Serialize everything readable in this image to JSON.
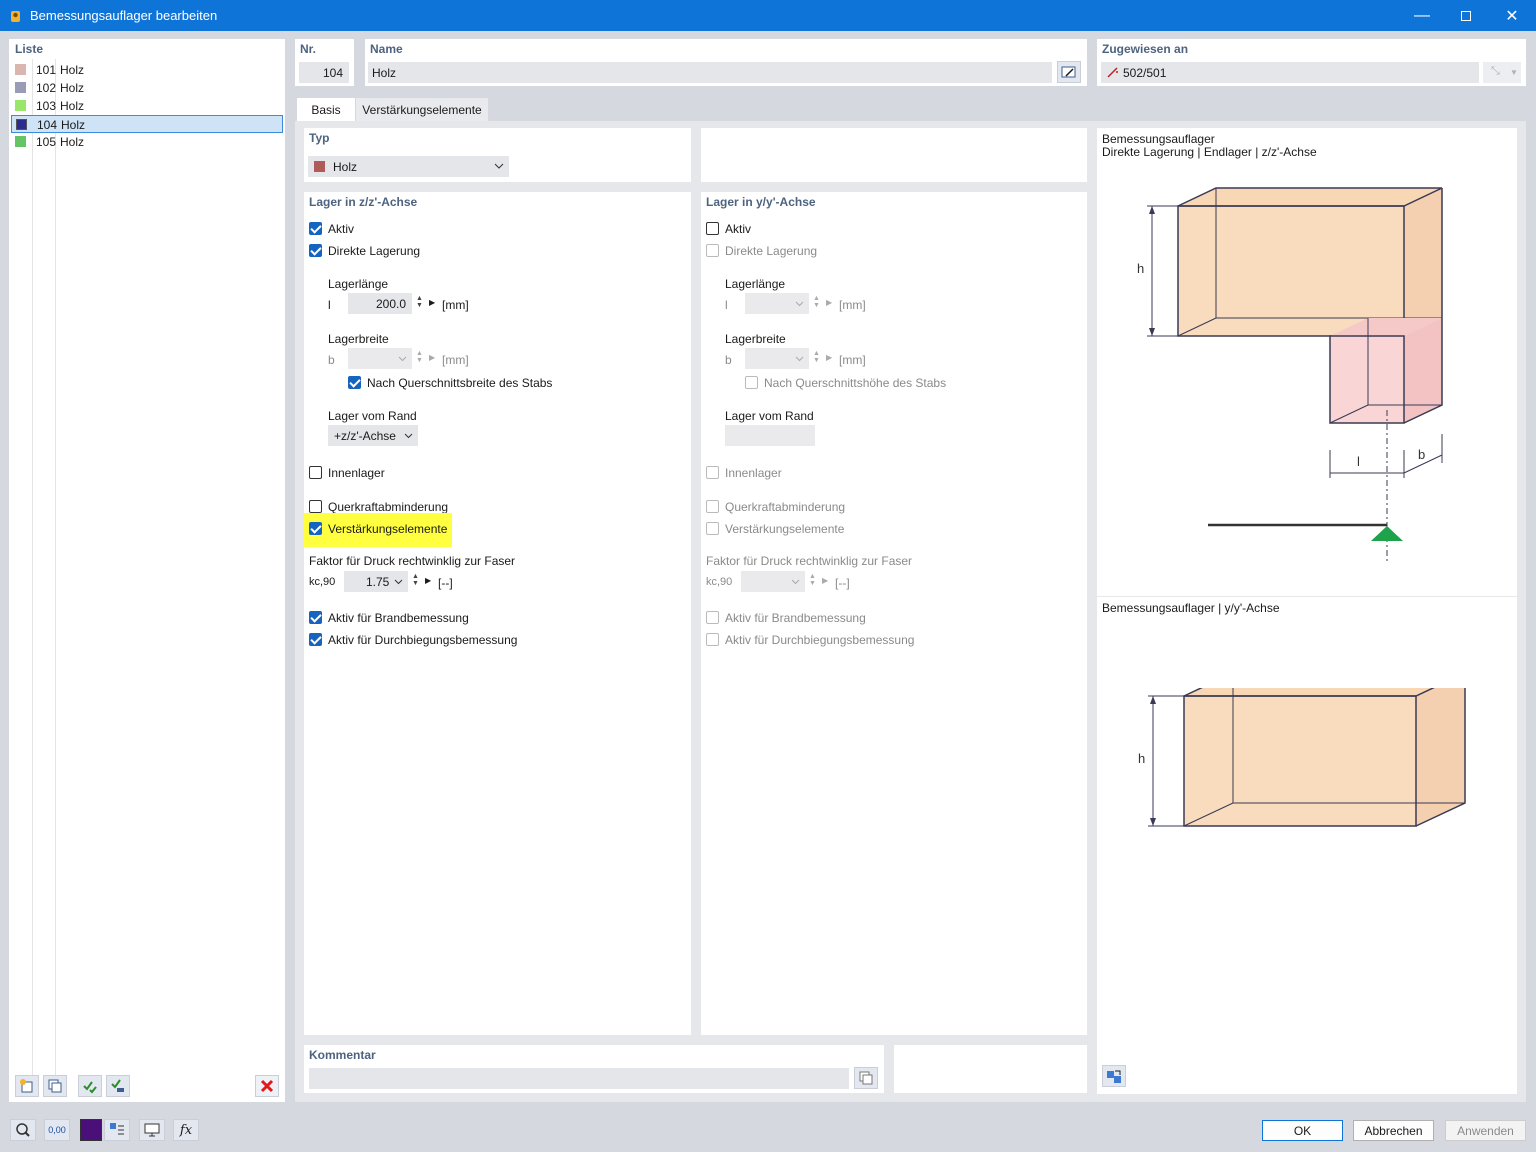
{
  "window": {
    "title": "Bemessungsauflager bearbeiten"
  },
  "list": {
    "header": "Liste",
    "items": [
      {
        "nr": "101",
        "name": "Holz",
        "color": "#d9b7b0"
      },
      {
        "nr": "102",
        "name": "Holz",
        "color": "#9a9bb5"
      },
      {
        "nr": "103",
        "name": "Holz",
        "color": "#9ae66a"
      },
      {
        "nr": "104",
        "name": "Holz",
        "color": "#2a2a8f",
        "selected": true
      },
      {
        "nr": "105",
        "name": "Holz",
        "color": "#66c466"
      }
    ]
  },
  "header": {
    "nr_label": "Nr.",
    "nr_value": "104",
    "name_label": "Name",
    "name_value": "Holz",
    "assigned_label": "Zugewiesen an",
    "assigned_value": "502/501"
  },
  "tabs": [
    "Basis",
    "Verstärkungselemente"
  ],
  "typ": {
    "label": "Typ",
    "value": "Holz",
    "color": "#b05a5a"
  },
  "z_axis": {
    "title": "Lager in z/z'-Achse",
    "aktiv": "Aktiv",
    "direkte": "Direkte Lagerung",
    "lagerlaenge": "Lagerlänge",
    "l_sym": "l",
    "l_value": "200.0",
    "unit_mm": "[mm]",
    "lagerbreite": "Lagerbreite",
    "b_sym": "b",
    "b_unit": "[mm]",
    "nach_q": "Nach Querschnittsbreite des Stabs",
    "lager_vom_rand": "Lager vom Rand",
    "rand_value": "+z/z'-Achse",
    "innenlager": "Innenlager",
    "querkraft": "Querkraftabminderung",
    "verstaerkung": "Verstärkungselemente",
    "faktor": "Faktor für Druck rechtwinklig zur Faser",
    "kc_sym": "kc,90",
    "kc_value": "1.75",
    "unit_dash": "[--]",
    "brand": "Aktiv für Brandbemessung",
    "durchbiegung": "Aktiv für Durchbiegungsbemessung"
  },
  "y_axis": {
    "title": "Lager in y/y'-Achse",
    "aktiv": "Aktiv",
    "direkte": "Direkte Lagerung",
    "lagerlaenge": "Lagerlänge",
    "l_sym": "l",
    "unit_mm": "[mm]",
    "lagerbreite": "Lagerbreite",
    "b_sym": "b",
    "b_unit": "[mm]",
    "nach_q": "Nach Querschnittshöhe des Stabs",
    "lager_vom_rand": "Lager vom Rand",
    "innenlager": "Innenlager",
    "querkraft": "Querkraftabminderung",
    "verstaerkung": "Verstärkungselemente",
    "faktor": "Faktor für Druck rechtwinklig zur Faser",
    "kc_sym": "kc,90",
    "unit_dash": "[--]",
    "brand": "Aktiv für Brandbemessung",
    "durchbiegung": "Aktiv für Durchbiegungsbemessung"
  },
  "kommentar": {
    "label": "Kommentar"
  },
  "preview": {
    "title1": "Bemessungsauflager",
    "subtitle1": "Direkte Lagerung | Endlager | z/z'-Achse",
    "title2": "Bemessungsauflager | y/y'-Achse",
    "h": "h",
    "l": "l",
    "b": "b"
  },
  "footer": {
    "ok": "OK",
    "cancel": "Abbrechen",
    "apply": "Anwenden",
    "decimals_icon_text": "0,00"
  }
}
